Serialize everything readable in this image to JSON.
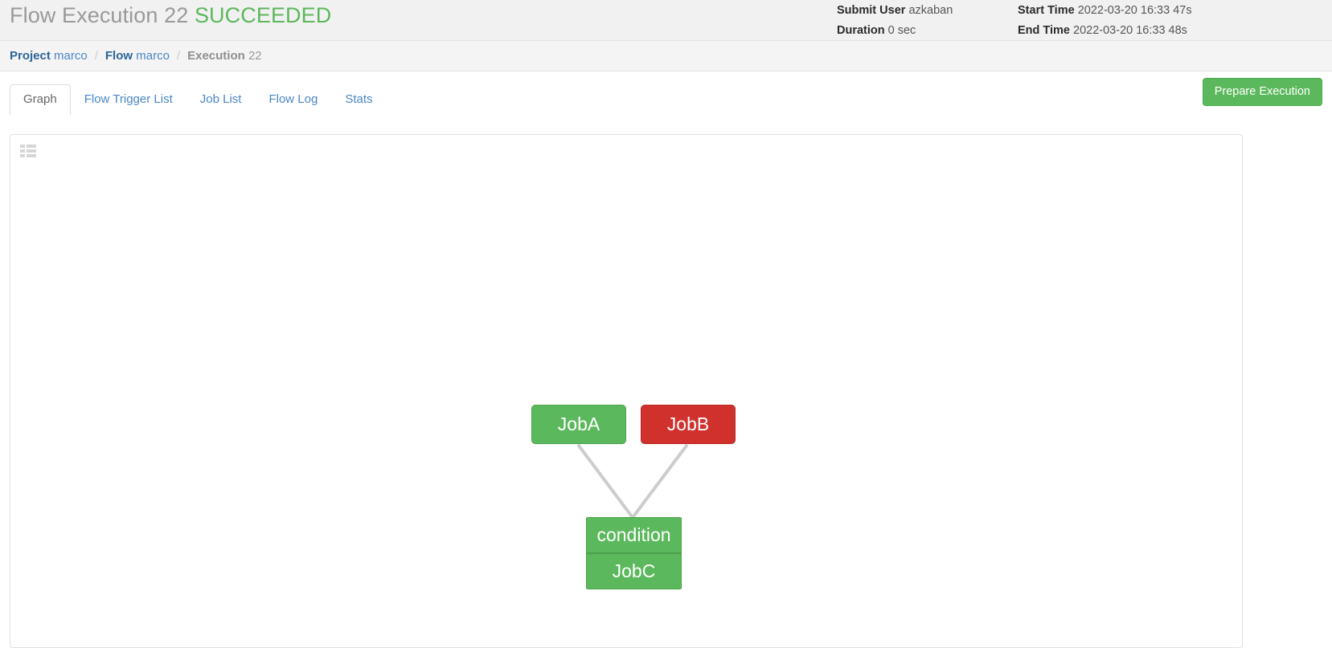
{
  "header": {
    "title_prefix": "Flow Execution 22",
    "status": "SUCCEEDED",
    "meta": {
      "submit_user_label": "Submit User",
      "submit_user_value": "azkaban",
      "duration_label": "Duration",
      "duration_value": "0 sec",
      "start_time_label": "Start Time",
      "start_time_value": "2022-03-20 16:33 47s",
      "end_time_label": "End Time",
      "end_time_value": "2022-03-20 16:33 48s"
    }
  },
  "breadcrumb": {
    "project_label": "Project",
    "project_value": "marco",
    "flow_label": "Flow",
    "flow_value": "marco",
    "execution_label": "Execution",
    "execution_value": "22",
    "separator": "/"
  },
  "tabs": [
    {
      "label": "Graph",
      "active": true
    },
    {
      "label": "Flow Trigger List",
      "active": false
    },
    {
      "label": "Job List",
      "active": false
    },
    {
      "label": "Flow Log",
      "active": false
    },
    {
      "label": "Stats",
      "active": false
    }
  ],
  "actions": {
    "prepare_execution_label": "Prepare Execution"
  },
  "panel": {
    "toolbar_icon": "th-list-icon"
  },
  "graph": {
    "nodes": [
      {
        "id": "JobA",
        "label": "JobA",
        "status": "SUCCEEDED",
        "color": "#5cb85c"
      },
      {
        "id": "JobB",
        "label": "JobB",
        "status": "FAILED",
        "color": "#d0312d"
      },
      {
        "id": "JobC",
        "label": "JobC",
        "condition_label": "condition",
        "status": "SUCCEEDED",
        "color": "#5cb85c"
      }
    ],
    "edges": [
      {
        "from": "JobA",
        "to": "JobC"
      },
      {
        "from": "JobB",
        "to": "JobC"
      }
    ],
    "edge_color": "#cccccc"
  },
  "colors": {
    "success": "#5cb85c",
    "failure": "#d0312d",
    "link": "#4a86c5",
    "header_bg": "#f1f1f1"
  }
}
